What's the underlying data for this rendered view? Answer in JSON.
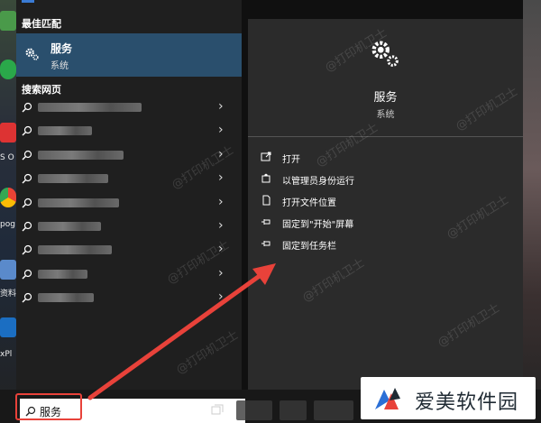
{
  "start_menu": {
    "best_match_label": "最佳匹配",
    "best_match": {
      "title": "服务",
      "subtitle": "系统",
      "icon": "gear-icon"
    },
    "web_search_label": "搜索网页",
    "web_results_count_visible": 9
  },
  "detail": {
    "title": "服务",
    "subtitle": "系统",
    "icon": "gear-icon",
    "actions": [
      {
        "label": "打开",
        "icon": "open-icon"
      },
      {
        "label": "以管理员身份运行",
        "icon": "shield-run-icon"
      },
      {
        "label": "打开文件位置",
        "icon": "file-location-icon"
      },
      {
        "label": "固定到\"开始\"屏幕",
        "icon": "pin-icon"
      },
      {
        "label": "固定到任务栏",
        "icon": "pin-icon"
      }
    ]
  },
  "taskbar": {
    "search_value": "服务"
  },
  "watermark": "@打印机卫士",
  "desktop": {
    "labels": [
      "S O",
      "pog",
      "资料",
      "xPl"
    ]
  },
  "logo": {
    "brand": "爱美软件园"
  },
  "colors": {
    "accent": "#2a4f6d",
    "highlight": "#e8423a",
    "arrow": "#e8423a"
  }
}
